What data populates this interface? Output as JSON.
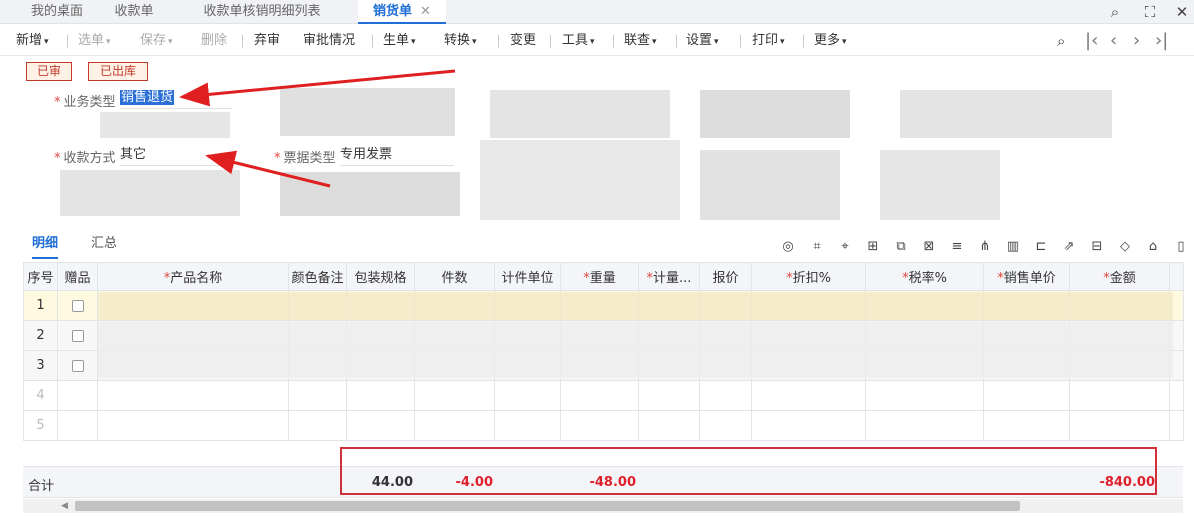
{
  "tabs": [
    {
      "label": "我的桌面"
    },
    {
      "label": "收款单"
    },
    {
      "label": "收款单核销明细列表"
    },
    {
      "label": "销货单"
    }
  ],
  "tab_close": "✕",
  "toolbar": {
    "new": "新增",
    "select": "选单",
    "save": "保存",
    "delete": "删除",
    "abandon": "弃审",
    "audit": "审批情况",
    "generate": "生单",
    "convert": "转换",
    "change": "变更",
    "tools": "工具",
    "query": "联查",
    "settings": "设置",
    "print": "打印",
    "more": "更多"
  },
  "badges": {
    "audited": "已审",
    "outbound": "已出库"
  },
  "form": {
    "business_type_label": "业务类型",
    "business_type_value": "销售退货",
    "payment_method_label": "收款方式",
    "payment_method_value": "其它",
    "invoice_type_label": "票据类型",
    "invoice_type_value": "专用发票"
  },
  "detail_tabs": {
    "detail": "明细",
    "summary": "汇总"
  },
  "grid": {
    "headers": {
      "seq": "序号",
      "gift": "赠品",
      "product": "产品名称",
      "color": "颜色备注",
      "pack": "包装规格",
      "pieces": "件数",
      "unit": "计件单位",
      "weight": "重量",
      "measure": "计量...",
      "quote": "报价",
      "discount": "折扣%",
      "tax": "税率%",
      "unit_price": "销售单价",
      "amount": "金额"
    },
    "rows": [
      "1",
      "2",
      "3",
      "4",
      "5"
    ]
  },
  "totals": {
    "label": "合计",
    "pieces": "44.00",
    "pieces_neg": "-4.00",
    "weight": "-48.00",
    "amount": "-840.00"
  },
  "colors": {
    "accent": "#1f6fd6",
    "negative": "#e0202a",
    "badge": "#c0392b",
    "highlight": "#d0303a"
  }
}
